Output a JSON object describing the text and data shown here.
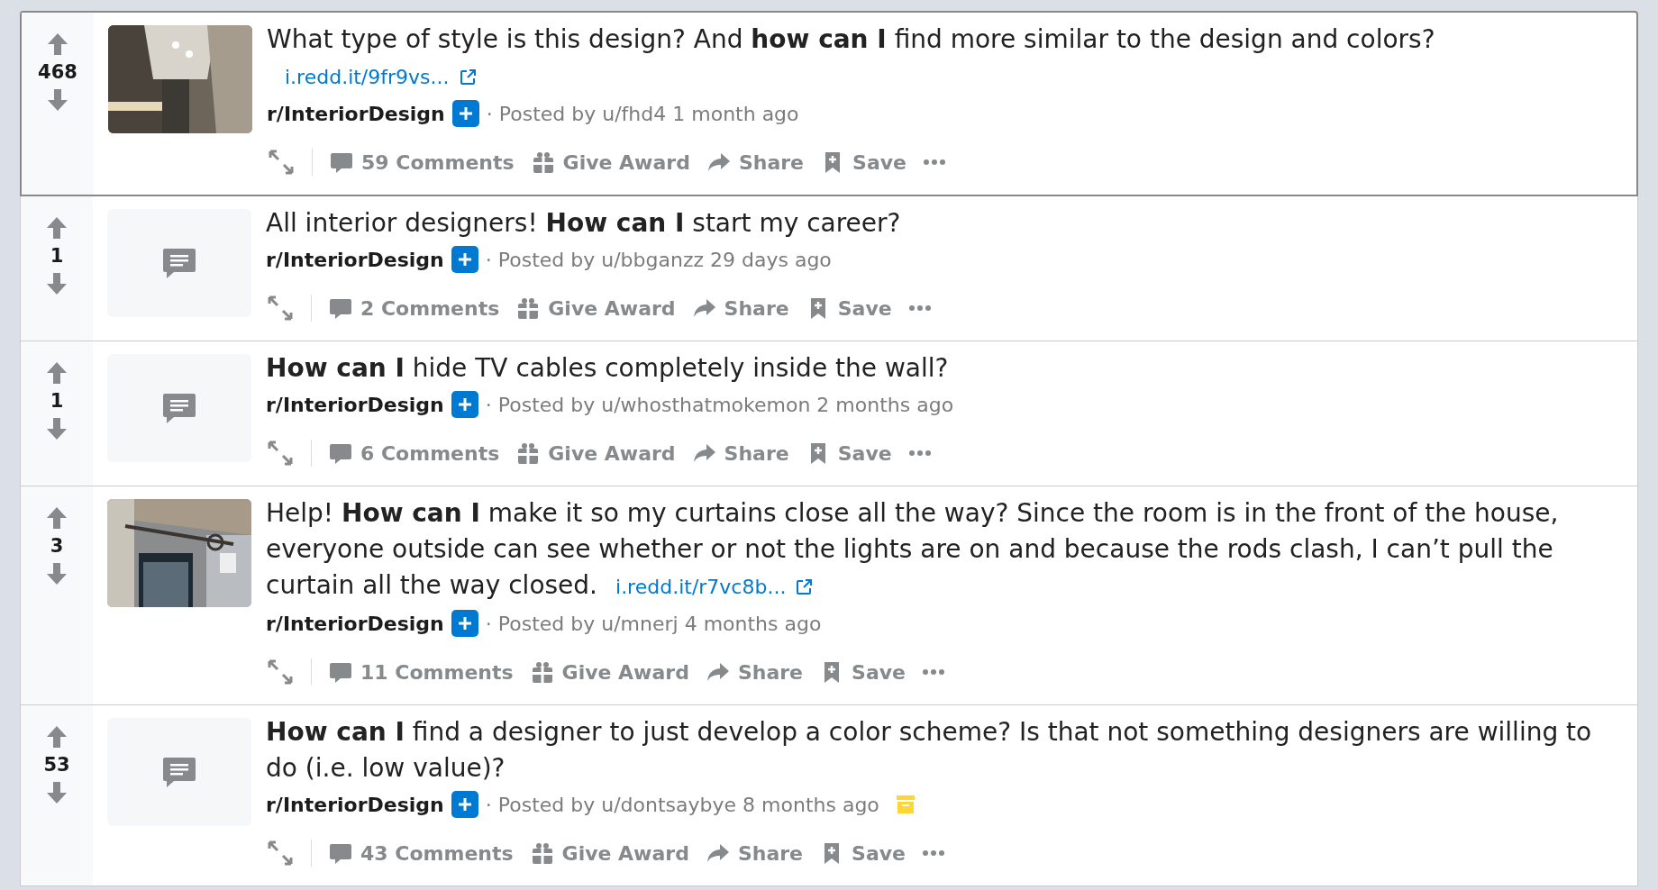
{
  "posts": [
    {
      "votes": "468",
      "highlighted": true,
      "kind": "picture",
      "title": "What type of style is this design? And **how can I** find more similar to the design and colors?",
      "link": "i.redd.it/9fr9vs...",
      "subreddit": "r/InteriorDesign",
      "posted": "· Posted by u/fhd4 1 month ago",
      "archived": false,
      "comments": "59 Comments",
      "award": "Give Award",
      "share": "Share",
      "save": "Save"
    },
    {
      "votes": "1",
      "highlighted": false,
      "kind": "text",
      "title": "All interior designers! **How can I** start my career?",
      "subreddit": "r/InteriorDesign",
      "posted": "· Posted by u/bbganzz 29 days ago",
      "archived": false,
      "comments": "2 Comments",
      "award": "Give Award",
      "share": "Share",
      "save": "Save"
    },
    {
      "votes": "1",
      "highlighted": false,
      "kind": "text",
      "title": "**How can I** hide TV cables completely inside the wall?",
      "subreddit": "r/InteriorDesign",
      "posted": "· Posted by u/whosthatmokemon 2 months ago",
      "archived": false,
      "comments": "6 Comments",
      "award": "Give Award",
      "share": "Share",
      "save": "Save"
    },
    {
      "votes": "3",
      "highlighted": false,
      "kind": "picture",
      "title": "Help! **How can I** make it so my curtains close all the way? Since the room is in the front of the house, everyone outside can see whether or not the lights are on and because the rods clash, I can’t pull the curtain all the way closed.",
      "link": "i.redd.it/r7vc8b...",
      "subreddit": "r/InteriorDesign",
      "posted": "· Posted by u/mnerj 4 months ago",
      "archived": false,
      "comments": "11 Comments",
      "award": "Give Award",
      "share": "Share",
      "save": "Save"
    },
    {
      "votes": "53",
      "highlighted": false,
      "kind": "text",
      "title": "**How can I** find a designer to just develop a color scheme? Is that not something designers are willing to do (i.e. low value)?",
      "subreddit": "r/InteriorDesign",
      "posted": "· Posted by u/dontsaybye 8 months ago",
      "archived": true,
      "comments": "43 Comments",
      "award": "Give Award",
      "share": "Share",
      "save": "Save"
    }
  ]
}
